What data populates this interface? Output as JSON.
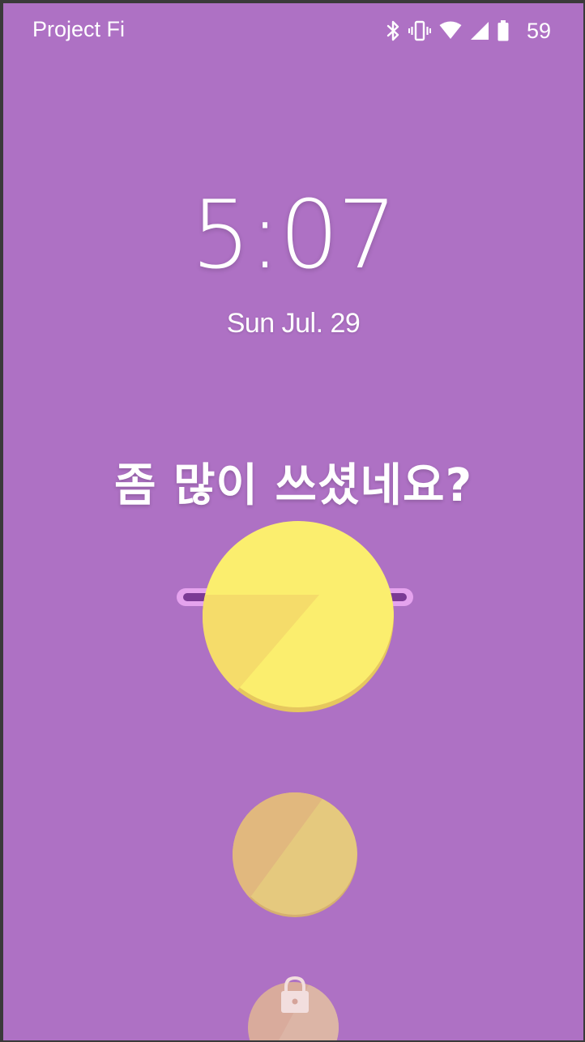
{
  "status_bar": {
    "carrier": "Project Fi",
    "battery_level": "59",
    "icons": [
      "bluetooth-icon",
      "vibrate-icon",
      "wifi-icon",
      "cell-signal-icon",
      "battery-icon"
    ]
  },
  "lockscreen": {
    "time": "5:07",
    "date": "Sun Jul. 29",
    "message": "좀 많이 쓰셨네요?"
  },
  "colors": {
    "background": "#ae71c4",
    "slot": "#e5a3ee",
    "slot_inner": "#7b3a95",
    "coin_main": "#fbee6e",
    "coin_shade": "#f5dc6a",
    "coin_edge": "#e6c75e",
    "coin_faded_main": "#e5c97e",
    "coin_faded_shade": "#e1b87e",
    "lock_circle": "#d8a8a8"
  },
  "graphics": {
    "top_object": "coin-dropping-into-slot",
    "middle_object": "faded-coin",
    "bottom_object": "lock-icon"
  }
}
